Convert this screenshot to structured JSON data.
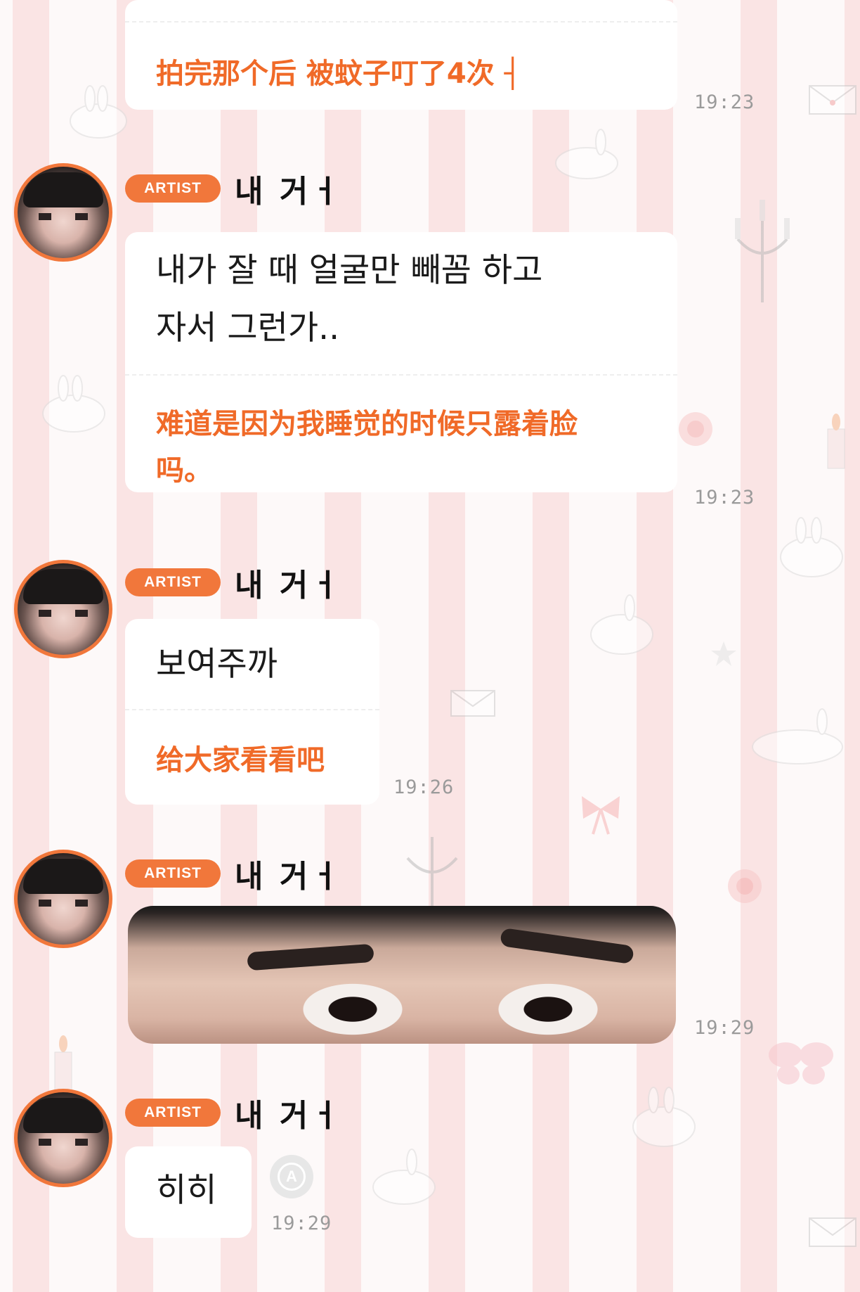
{
  "theme": {
    "accent": "#f1773b",
    "chinese_text_color": "#f06a28",
    "badge_color": "#f1773b"
  },
  "messages": [
    {
      "korean": "",
      "chinese": "拍完那个后 被蚊子叮了4次 ┤",
      "time": "19:23"
    },
    {
      "badge": "ARTIST",
      "sender": "내 거ㅓ",
      "korean_line1": "내가 잘 때 얼굴만 빼꼼 하고",
      "korean_line2": "자서 그런가..",
      "chinese_line1": "难道是因为我睡觉的时候只露着脸",
      "chinese_line2": "吗。",
      "time": "19:23"
    },
    {
      "badge": "ARTIST",
      "sender": "내 거ㅓ",
      "korean": "보여주까",
      "chinese": "给大家看看吧",
      "time": "19:26"
    },
    {
      "badge": "ARTIST",
      "sender": "내 거ㅓ",
      "image_icon": "photo-eyes",
      "time": "19:29"
    },
    {
      "badge": "ARTIST",
      "sender": "내 거ㅓ",
      "korean": "히히",
      "translate_icon": "translate-icon",
      "time": "19:29"
    }
  ]
}
